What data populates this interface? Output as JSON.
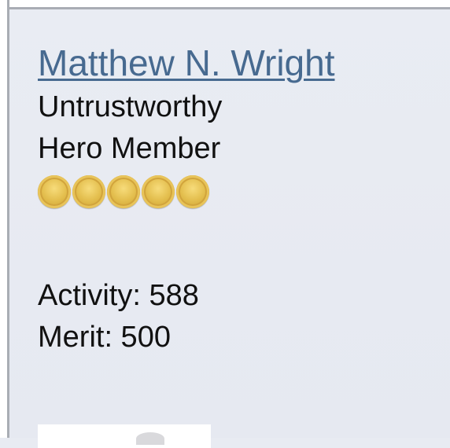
{
  "profile": {
    "username": "Matthew N. Wright",
    "trust_label": "Untrustworthy",
    "rank": "Hero Member",
    "rank_coins": 5,
    "coin_color": "#e4bf4f",
    "username_color": "#476a90"
  },
  "stats": {
    "activity": "Activity: 588",
    "merit": "Merit: 500"
  }
}
